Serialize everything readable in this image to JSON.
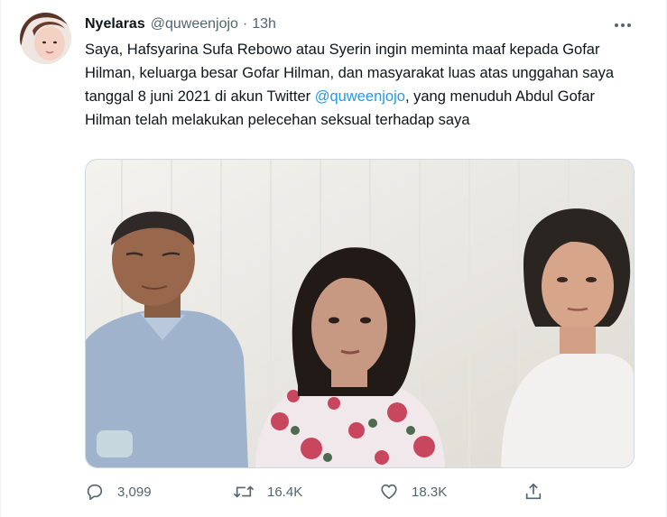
{
  "tweet": {
    "author_name": "Nyelaras",
    "author_handle": "@quweenjojo",
    "separator": "·",
    "time": "13h",
    "text_part1": "Saya, Hafsyarina Sufa Rebowo atau Syerin ingin meminta maaf kepada Gofar Hilman, keluarga besar Gofar Hilman, dan masyarakat luas atas unggahan saya tanggal 8 juni 2021 di akun Twitter ",
    "mention": "@quweenjojo",
    "text_part2": ", yang menuduh Abdul Gofar Hilman telah melakukan pelecehan seksual terhadap saya"
  },
  "actions": {
    "reply_count": "3,099",
    "retweet_count": "16.4K",
    "like_count": "18.3K"
  },
  "colors": {
    "accent": "#1d9bf0",
    "secondary_text": "#536471",
    "primary_text": "#0f1419"
  },
  "icons": {
    "more": "more-dots-icon",
    "reply": "reply-icon",
    "retweet": "retweet-icon",
    "like": "heart-icon",
    "share": "share-icon"
  }
}
